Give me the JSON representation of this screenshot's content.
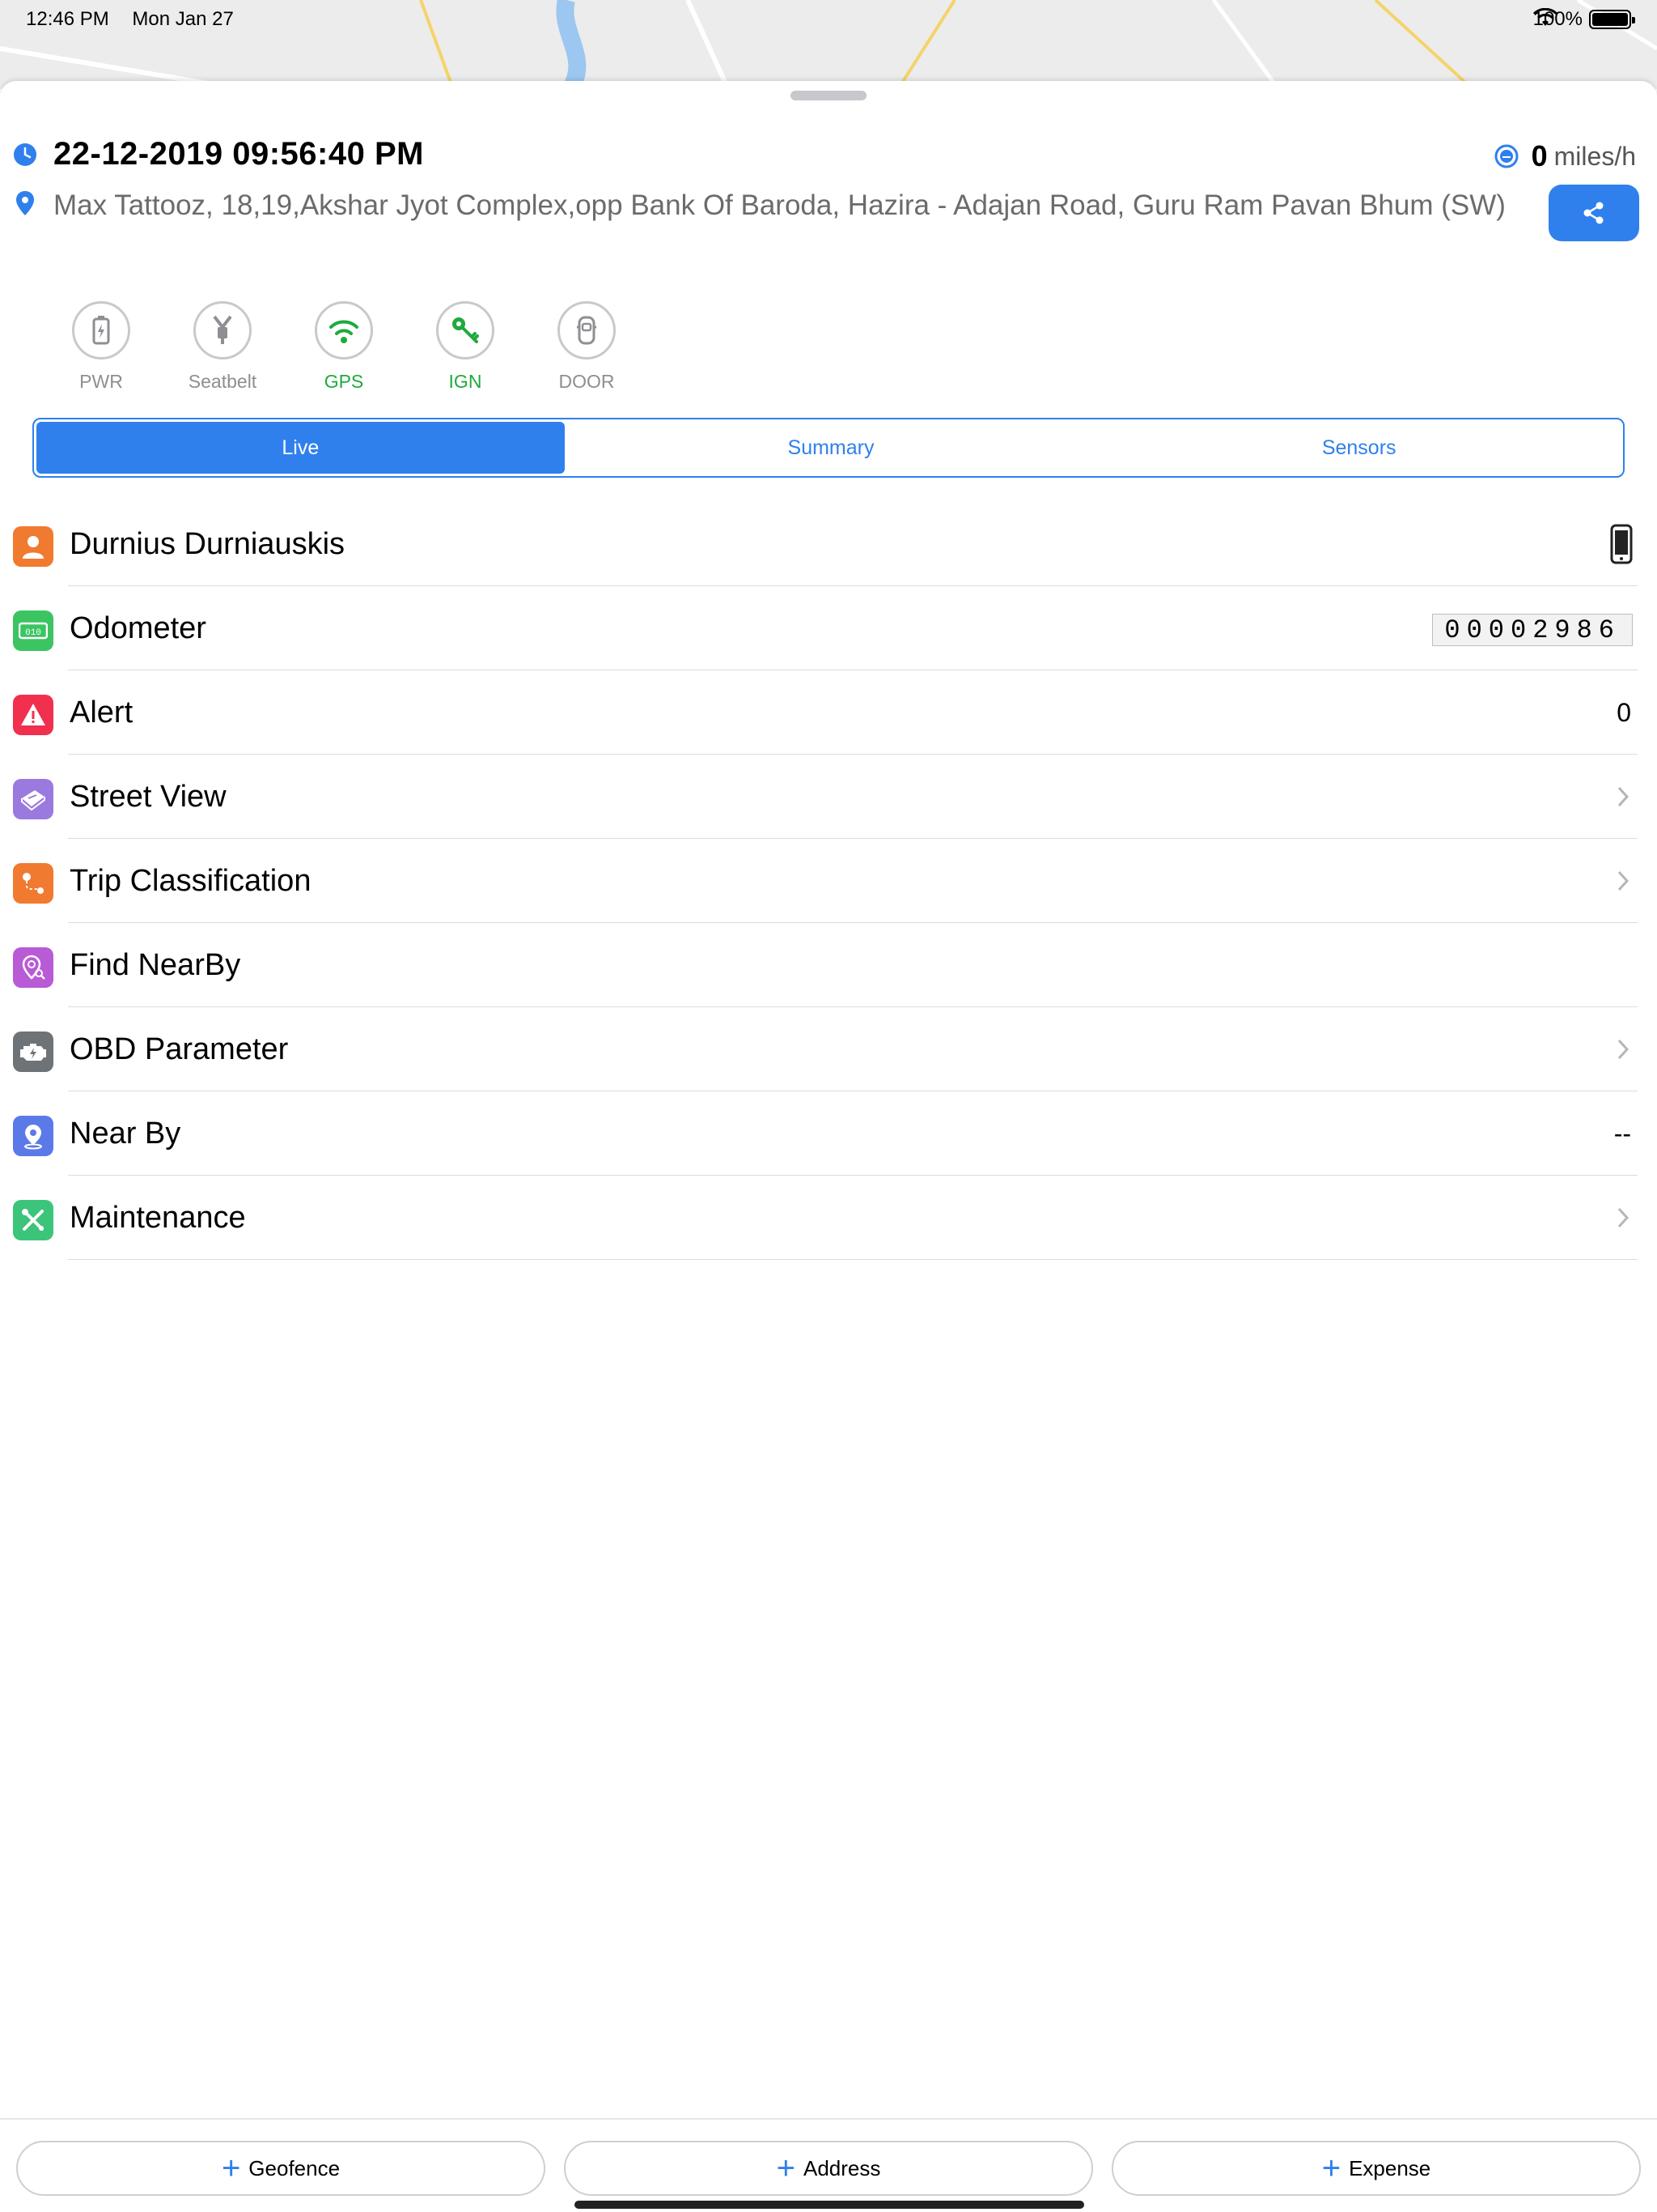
{
  "status_bar": {
    "time": "12:46 PM",
    "date": "Mon Jan 27",
    "battery": "100%"
  },
  "header": {
    "datetime": "22-12-2019 09:56:40 PM",
    "speed_value": "0",
    "speed_unit": "miles/h",
    "address": "Max Tattooz, 18,19,Akshar Jyot Complex,opp Bank Of Baroda, Hazira - Adajan Road, Guru Ram Pavan Bhum (SW)"
  },
  "status_icons": [
    {
      "label": "PWR",
      "icon": "battery-icon",
      "active": false
    },
    {
      "label": "Seatbelt",
      "icon": "seatbelt-icon",
      "active": false
    },
    {
      "label": "GPS",
      "icon": "wifi-signal-icon",
      "active": true
    },
    {
      "label": "IGN",
      "icon": "key-icon",
      "active": true
    },
    {
      "label": "DOOR",
      "icon": "car-door-icon",
      "active": false
    }
  ],
  "tabs": [
    {
      "label": "Live",
      "active": true
    },
    {
      "label": "Summary",
      "active": false
    },
    {
      "label": "Sensors",
      "active": false
    }
  ],
  "list": [
    {
      "title": "Durnius Durniauskis",
      "icon": "person-icon",
      "color": "#f07a2f",
      "trail_type": "phone"
    },
    {
      "title": "Odometer",
      "icon": "odometer-icon",
      "color": "#3cc462",
      "trail_type": "odometer",
      "trail": "00002986"
    },
    {
      "title": "Alert",
      "icon": "alert-icon",
      "color": "#f0304e",
      "trail_type": "text",
      "trail": "0"
    },
    {
      "title": "Street View",
      "icon": "street-view-icon",
      "color": "#9b7ae0",
      "trail_type": "chevron"
    },
    {
      "title": "Trip Classification",
      "icon": "trip-icon",
      "color": "#f07a2f",
      "trail_type": "chevron"
    },
    {
      "title": "Find NearBy",
      "icon": "find-nearby-icon",
      "color": "#b95ad6",
      "trail_type": "none"
    },
    {
      "title": "OBD Parameter",
      "icon": "engine-icon",
      "color": "#6e7377",
      "trail_type": "chevron"
    },
    {
      "title": "Near By",
      "icon": "location-pin-icon",
      "color": "#5b7ae8",
      "trail_type": "text",
      "trail": "--"
    },
    {
      "title": "Maintenance",
      "icon": "tools-icon",
      "color": "#3cc47a",
      "trail_type": "chevron"
    }
  ],
  "bottom_buttons": [
    {
      "label": "Geofence"
    },
    {
      "label": "Address"
    },
    {
      "label": "Expense"
    }
  ],
  "colors": {
    "accent": "#2f80ed",
    "active_green": "#1faa3c"
  }
}
